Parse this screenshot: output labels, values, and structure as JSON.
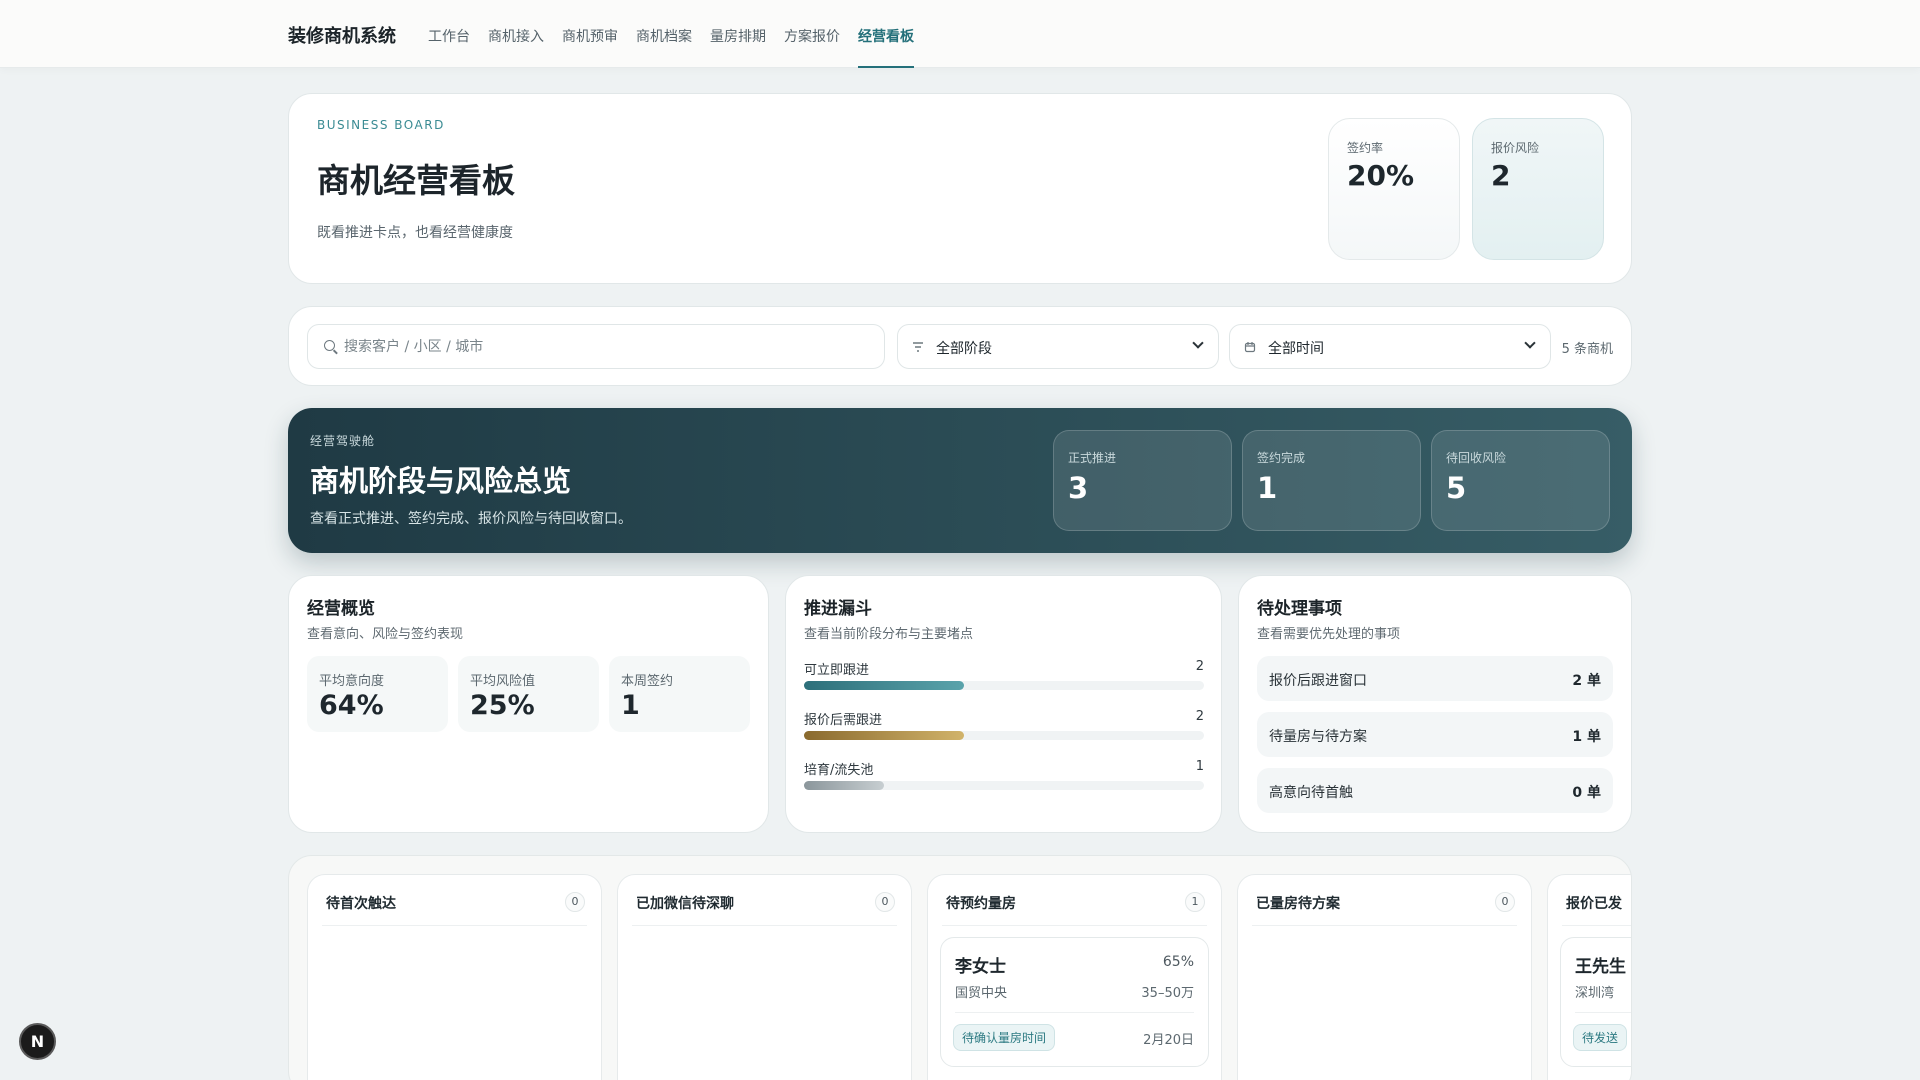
{
  "app": {
    "brand": "装修商机系统",
    "nav": [
      "工作台",
      "商机接入",
      "商机预审",
      "商机档案",
      "量房排期",
      "方案报价",
      "经营看板"
    ],
    "active_nav": "经营看板"
  },
  "hero": {
    "eyebrow": "BUSINESS BOARD",
    "title": "商机经营看板",
    "desc": "既看推进卡点，也看经营健康度",
    "stats": [
      {
        "label": "签约率",
        "value": "20%"
      },
      {
        "label": "报价风险",
        "value": "2"
      }
    ]
  },
  "filters": {
    "search_placeholder": "搜索客户 / 小区 / 城市",
    "stage_select": "全部阶段",
    "time_select": "全部时间",
    "count": "5 条商机",
    "stage_icon": "filter-icon",
    "time_icon": "calendar-icon"
  },
  "overview_banner": {
    "eyebrow": "经营驾驶舱",
    "title": "商机阶段与风险总览",
    "desc": "查看正式推进、签约完成、报价风险与待回收窗口。",
    "stats": [
      {
        "label": "正式推进",
        "value": "3"
      },
      {
        "label": "签约完成",
        "value": "1"
      },
      {
        "label": "待回收风险",
        "value": "5"
      }
    ]
  },
  "business_overview": {
    "title": "经营概览",
    "sub": "查看意向、风险与签约表现",
    "cards": [
      {
        "label": "平均意向度",
        "value": "64%"
      },
      {
        "label": "平均风险值",
        "value": "25%"
      },
      {
        "label": "本周签约",
        "value": "1"
      }
    ]
  },
  "funnel": {
    "title": "推进漏斗",
    "sub": "查看当前阶段分布与主要堵点",
    "rows": [
      {
        "label": "可立即跟进",
        "count": "2",
        "fill_fraction": 0.4,
        "color_from": "#2d6f7a",
        "color_to": "#5aa3ab"
      },
      {
        "label": "报价后需跟进",
        "count": "2",
        "fill_fraction": 0.4,
        "color_from": "#8a6a2e",
        "color_to": "#d1b36a"
      },
      {
        "label": "培育/流失池",
        "count": "1",
        "fill_fraction": 0.2,
        "color_from": "#8b969b",
        "color_to": "#c7ced1"
      }
    ]
  },
  "todo": {
    "title": "待处理事项",
    "sub": "查看需要优先处理的事项",
    "rows": [
      {
        "label": "报价后跟进窗口",
        "value": "2 单"
      },
      {
        "label": "待量房与待方案",
        "value": "1 单"
      },
      {
        "label": "高意向待首触",
        "value": "0 单"
      }
    ]
  },
  "kanban": {
    "columns": [
      {
        "title": "待首次触达",
        "count": "0"
      },
      {
        "title": "已加微信待深聊",
        "count": "0"
      },
      {
        "title": "待预约量房",
        "count": "1",
        "deal": {
          "name": "李女士",
          "pct": "65%",
          "area": "国贸中央",
          "budget": "35–50万",
          "tag": "待确认量房时间",
          "date": "2月20日"
        }
      },
      {
        "title": "已量房待方案",
        "count": "0"
      },
      {
        "title": "报价已发",
        "count": "",
        "deal": {
          "name": "王先生",
          "pct": "",
          "area": "深圳湾",
          "budget": "",
          "tag": "待发送",
          "date": ""
        }
      }
    ]
  },
  "badge": "N",
  "colors": {
    "accent": "#24707a",
    "dark_panel": "#1f3a44"
  }
}
